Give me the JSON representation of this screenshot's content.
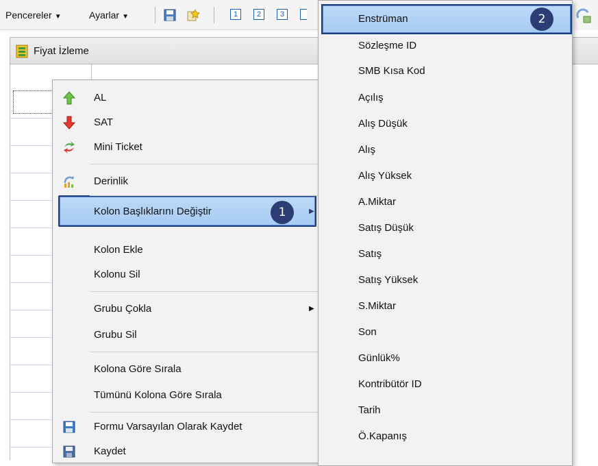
{
  "toolbar": {
    "windows_label": "Pencereler",
    "settings_label": "Ayarlar",
    "layout_numbers": [
      "1",
      "2",
      "3"
    ]
  },
  "panel": {
    "title": "Fiyat İzleme"
  },
  "context_menu": {
    "items": [
      {
        "label": "AL",
        "icon": "arrow-up-green-icon"
      },
      {
        "label": "SAT",
        "icon": "arrow-down-red-icon"
      },
      {
        "label": "Mini Ticket",
        "icon": "mini-ticket-icon"
      },
      {
        "label": "Derinlik",
        "icon": "depth-icon"
      },
      {
        "label": "Kolon Başlıklarını Değiştir",
        "icon": "",
        "highlighted": true,
        "has_submenu": true
      },
      {
        "label": "Kolon Ekle",
        "icon": ""
      },
      {
        "label": "Kolonu Sil",
        "icon": ""
      },
      {
        "label": "Grubu Çokla",
        "icon": "",
        "has_submenu": true
      },
      {
        "label": "Grubu Sil",
        "icon": ""
      },
      {
        "label": "Kolona Göre Sırala",
        "icon": ""
      },
      {
        "label": "Tümünü Kolona Göre Sırala",
        "icon": ""
      },
      {
        "label": "Formu Varsayılan Olarak Kaydet",
        "icon": "save-default-icon"
      },
      {
        "label": "Kaydet",
        "icon": "save-icon"
      }
    ],
    "step_badge": "1"
  },
  "submenu": {
    "items": [
      "Enstrüman",
      "Sözleşme ID",
      "SMB Kısa Kod",
      "Açılış",
      "Alış Düşük",
      "Alış",
      "Alış Yüksek",
      "A.Miktar",
      "Satış Düşük",
      "Satış",
      "Satış Yüksek",
      "S.Miktar",
      "Son",
      "Günlük%",
      "Kontribütör ID",
      "Tarih",
      "Ö.Kapanış"
    ],
    "step_badge": "2"
  },
  "colors": {
    "highlight": "#a6cbf2",
    "highlight_border": "#1c3f7d",
    "badge": "#2b3d74",
    "menu_bg": "#f2f2f2"
  }
}
